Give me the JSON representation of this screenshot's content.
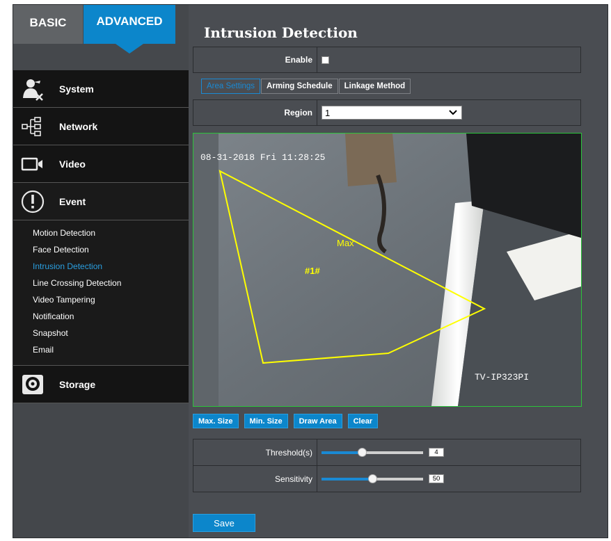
{
  "tabs": {
    "basic": "BASIC",
    "advanced": "ADVANCED"
  },
  "menu": {
    "system": "System",
    "network": "Network",
    "video": "Video",
    "event": "Event",
    "storage": "Storage",
    "event_items": [
      "Motion Detection",
      "Face Detection",
      "Intrusion Detection",
      "Line Crossing Detection",
      "Video Tampering",
      "Notification",
      "Snapshot",
      "Email"
    ]
  },
  "page": {
    "title": "Intrusion Detection"
  },
  "enable": {
    "label": "Enable",
    "checked": true
  },
  "subtabs": [
    "Area Settings",
    "Arming Schedule",
    "Linkage Method"
  ],
  "region": {
    "label": "Region",
    "value": "1"
  },
  "video": {
    "timestamp": "08-31-2018 Fri 11:28:25",
    "camera_name": "TV-IP323PI",
    "max_label": "Max",
    "area_label": "#1#"
  },
  "buttons": {
    "max_size": "Max. Size",
    "min_size": "Min. Size",
    "draw_area": "Draw Area",
    "clear": "Clear"
  },
  "threshold": {
    "label": "Threshold(s)",
    "value": "4",
    "fraction": 0.4
  },
  "sensitivity": {
    "label": "Sensitivity",
    "value": "50",
    "fraction": 0.5
  },
  "save_label": "Save",
  "colors": {
    "accent": "#0c86cb",
    "region_line": "#ffff00",
    "video_border": "#2bc43a"
  }
}
